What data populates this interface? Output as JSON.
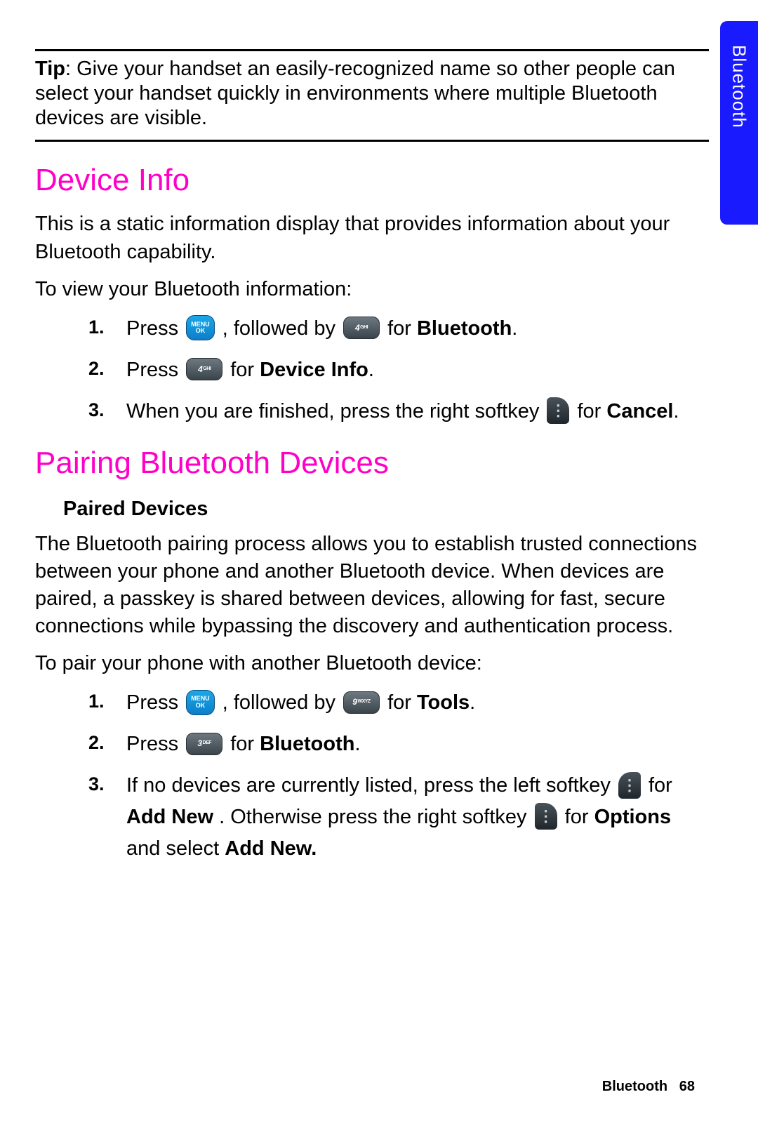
{
  "sideTab": "Bluetooth",
  "tip": {
    "label": "Tip",
    "text": ": Give your handset an easily-recognized name so other people can select your handset quickly in environments where multiple Bluetooth devices are visible."
  },
  "sec1": {
    "title": "Device Info",
    "p1": "This is a static information display that provides information about your Bluetooth capability.",
    "p2": "To view your Bluetooth information:",
    "steps": {
      "s1": {
        "a": "Press ",
        "b": ", followed by ",
        "c": " for ",
        "bold": "Bluetooth",
        "d": "."
      },
      "s2": {
        "a": "Press ",
        "b": " for ",
        "bold": "Device Info",
        "c": "."
      },
      "s3": {
        "a": "When you are finished, press the right softkey ",
        "b": " for ",
        "bold": "Cancel",
        "c": "."
      }
    }
  },
  "sec2": {
    "title": "Pairing Bluetooth Devices",
    "sub": "Paired Devices",
    "p1": "The Bluetooth pairing process allows you to establish trusted connections between your phone and another Bluetooth device. When devices are paired, a passkey is shared between devices, allowing for fast, secure connections while bypassing the discovery and authentication process.",
    "p2": "To pair your phone with another Bluetooth device:",
    "steps": {
      "s1": {
        "a": "Press ",
        "b": ", followed by ",
        "c": " for ",
        "bold": "Tools",
        "d": "."
      },
      "s2": {
        "a": "Press ",
        "b": " for ",
        "bold": "Bluetooth",
        "c": "."
      },
      "s3": {
        "a": "If no devices are currently listed, press the left softkey ",
        "b": " for ",
        "bold1": "Add New",
        "c": ". Otherwise press the right softkey ",
        "d": " for ",
        "bold2": "Options",
        "e": " and select ",
        "bold3": "Add New."
      }
    }
  },
  "keys": {
    "menu1": "MENU",
    "menu2": "OK",
    "k4": "4",
    "k4s": "GHI",
    "k9": "9",
    "k9s": "WXYZ",
    "k3": "3",
    "k3s": "DEF"
  },
  "footer": {
    "section": "Bluetooth",
    "page": "68"
  }
}
